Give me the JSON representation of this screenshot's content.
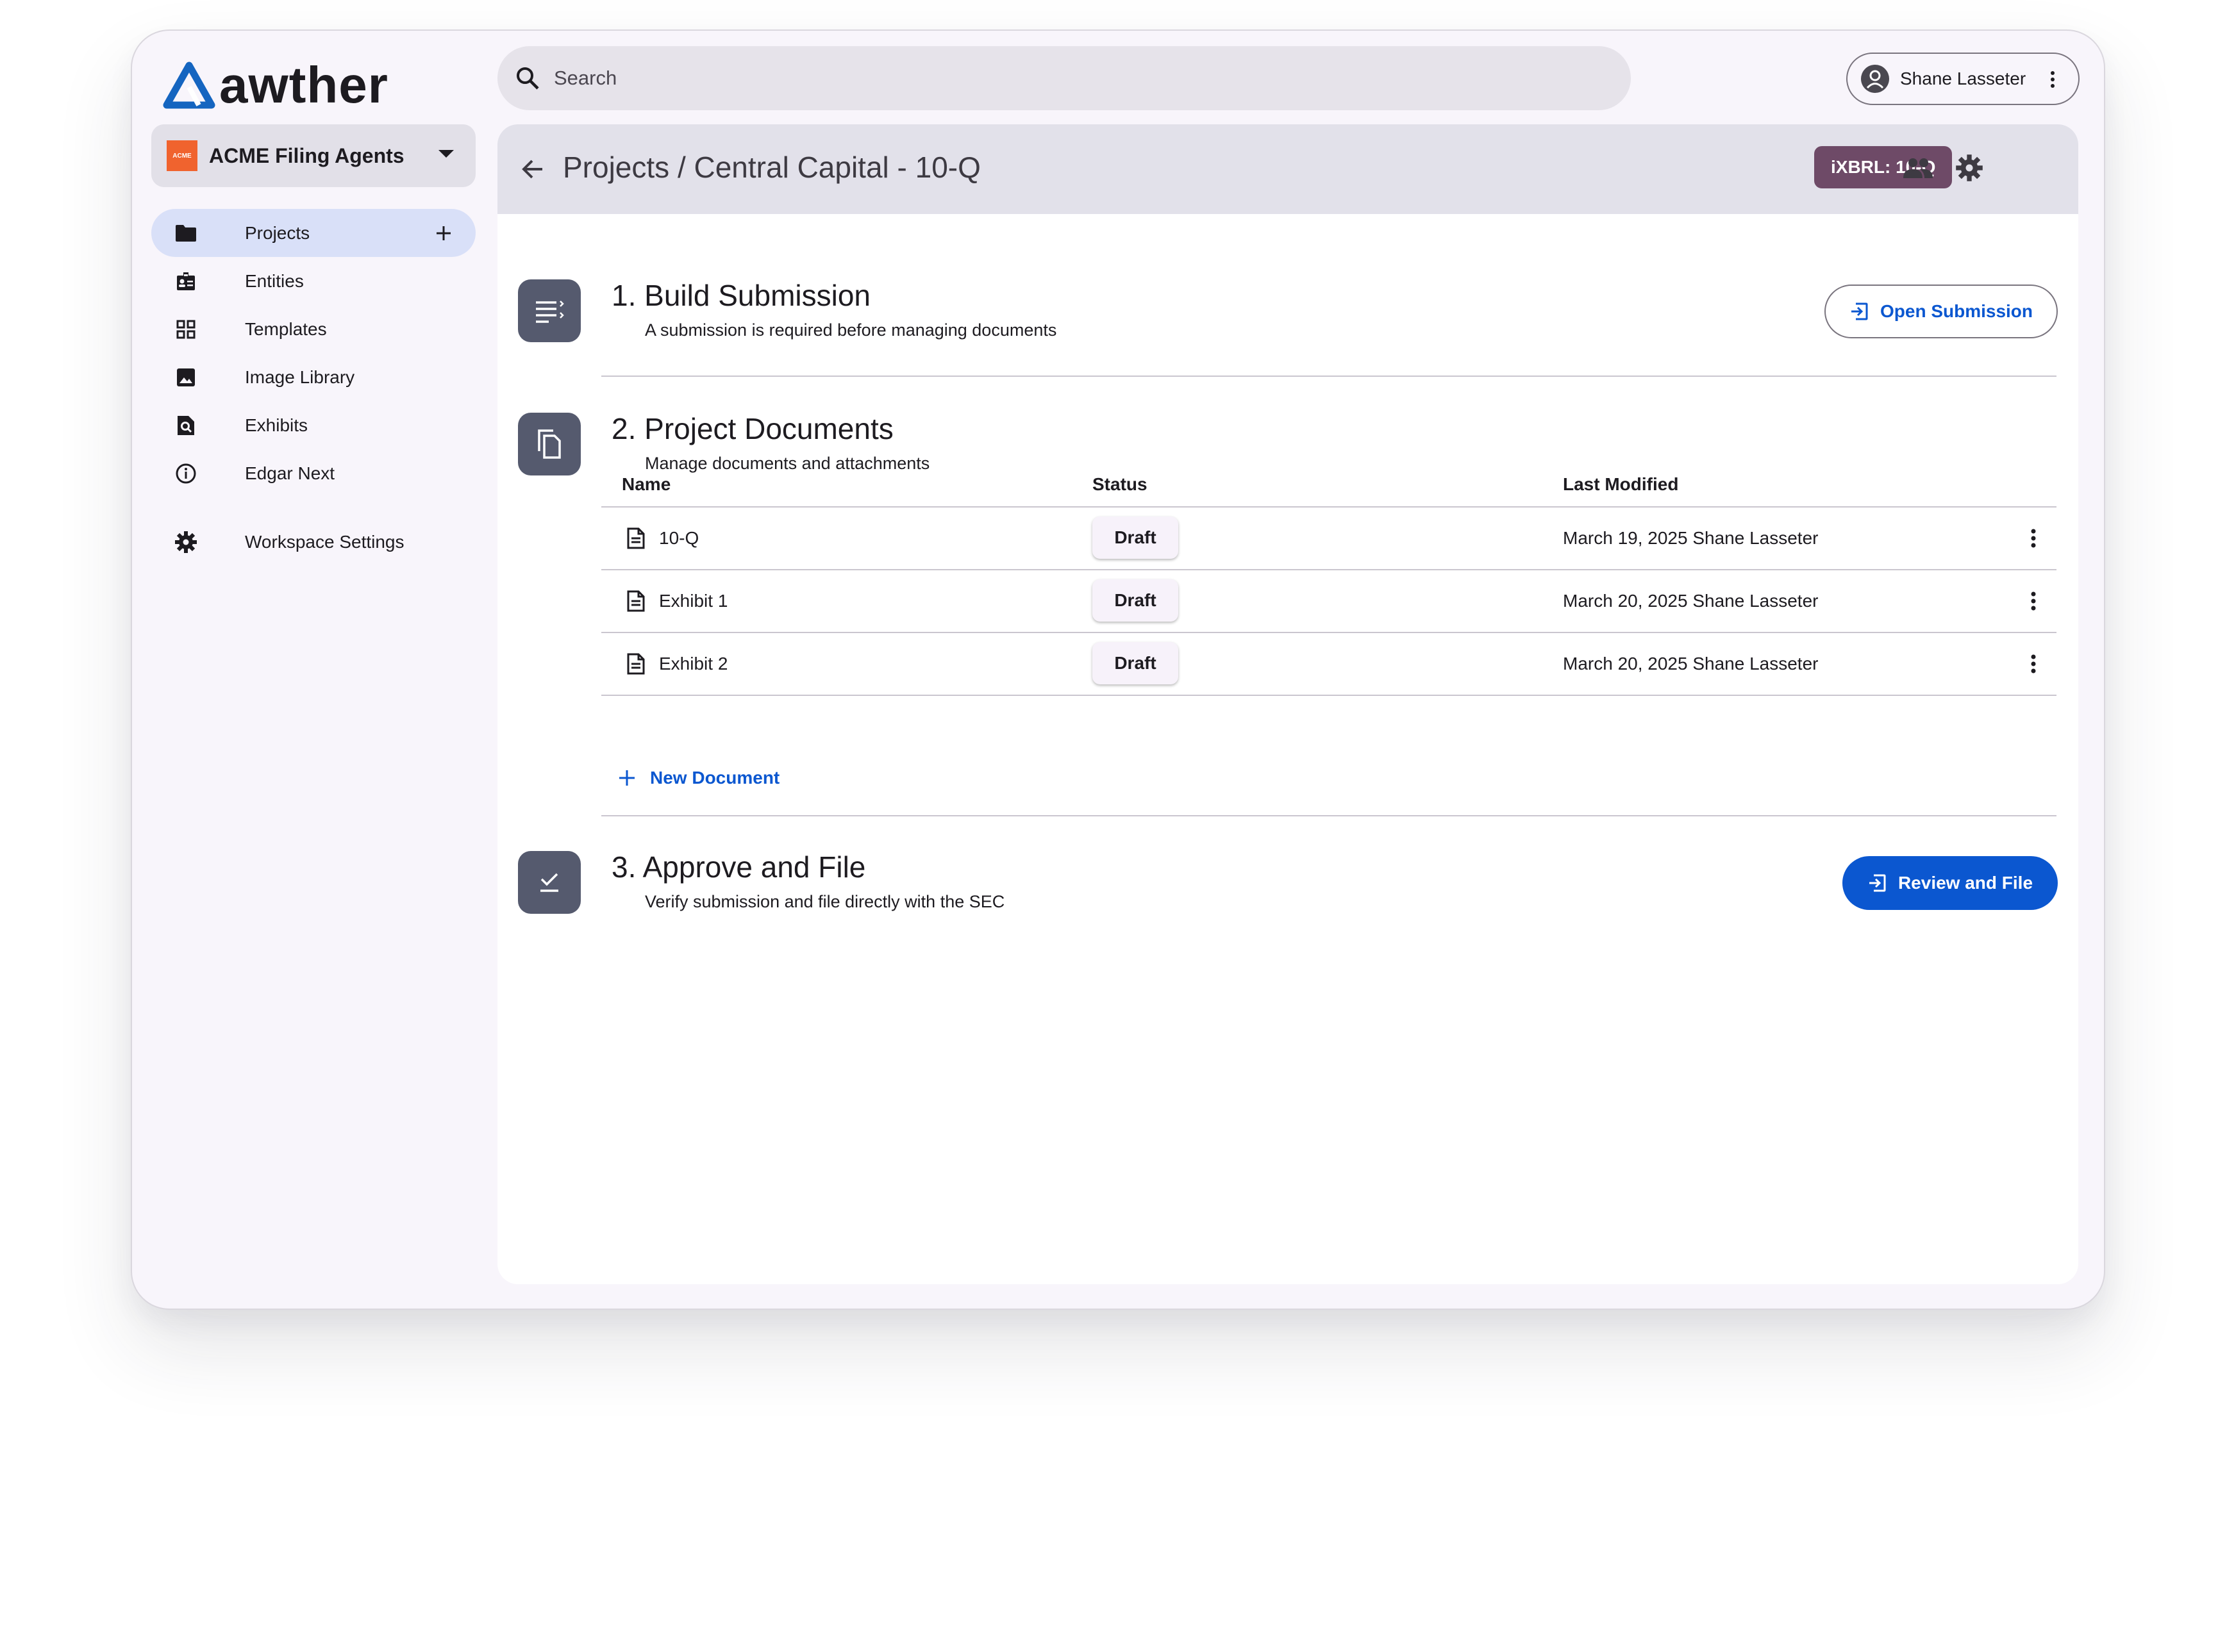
{
  "app": {
    "logo_text": "awther"
  },
  "org": {
    "name": "ACME Filing Agents",
    "logo_text": "ACME"
  },
  "search": {
    "placeholder": "Search"
  },
  "user": {
    "name": "Shane Lasseter"
  },
  "sidebar": {
    "items": [
      {
        "label": "Projects",
        "icon": "folder-icon",
        "active": true
      },
      {
        "label": "Entities",
        "icon": "entity-badge-icon"
      },
      {
        "label": "Templates",
        "icon": "grid-icon"
      },
      {
        "label": "Image Library",
        "icon": "image-icon"
      },
      {
        "label": "Exhibits",
        "icon": "document-search-icon"
      },
      {
        "label": "Edgar Next",
        "icon": "info-icon"
      }
    ],
    "settings_label": "Workspace Settings"
  },
  "header": {
    "breadcrumb": "Projects / Central Capital - 10-Q",
    "badge": "iXBRL: 10-Q",
    "badge_color": "#6e4a67"
  },
  "steps": [
    {
      "number": "1.",
      "title": "Build Submission",
      "subtitle": "A submission is required before managing documents",
      "action": "Open Submission"
    },
    {
      "number": "2.",
      "title": "Project Documents",
      "subtitle": "Manage documents and attachments"
    },
    {
      "number": "3.",
      "title": "Approve and File",
      "subtitle": "Verify submission and file directly with the SEC",
      "action": "Review and File"
    }
  ],
  "documents": {
    "columns": [
      "Name",
      "Status",
      "Last Modified"
    ],
    "rows": [
      {
        "name": "10-Q",
        "status": "Draft",
        "modified": "March 19, 2025 Shane Lasseter"
      },
      {
        "name": "Exhibit 1",
        "status": "Draft",
        "modified": "March 20, 2025 Shane Lasseter"
      },
      {
        "name": "Exhibit 2",
        "status": "Draft",
        "modified": "March 20, 2025 Shane Lasseter"
      }
    ],
    "new_label": "New Document"
  },
  "colors": {
    "accent": "#0b57d0",
    "step_icon_bg": "#555a6e",
    "nav_active": "#d9e0f8"
  }
}
